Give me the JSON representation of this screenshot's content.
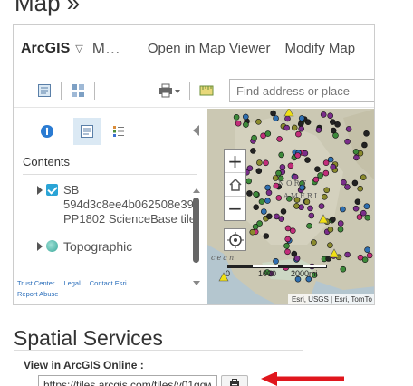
{
  "page": {
    "heading": "Map »"
  },
  "embed": {
    "brand": "ArcGIS",
    "map_title": "M…",
    "links": {
      "open": "Open in Map Viewer",
      "modify": "Modify Map"
    },
    "search": {
      "placeholder": "Find address or place"
    },
    "panel": {
      "contents_label": "Contents",
      "layers": [
        {
          "lines": [
            "SB",
            "594d3c8ee4b062508e39",
            "PP1802 ScienceBase tile"
          ]
        },
        {
          "label": "Topographic"
        }
      ],
      "footer_links": [
        "Trust Center",
        "Legal",
        "Contact Esri",
        "Report Abuse"
      ]
    },
    "map": {
      "labels": [
        "NORT",
        "AMERI",
        "cean"
      ],
      "scale": {
        "left": "0",
        "mid": "1000",
        "right": "2000mi"
      },
      "attribution": "Esri, USGS | Esri, TomTo"
    }
  },
  "services": {
    "heading": "Spatial Services",
    "view_label": "View in ArcGIS Online :",
    "url_value": "https://tiles.arcgis.com/tiles/v01gqw"
  },
  "colors": {
    "accent": "#2aa4d6",
    "annotation": "#e0161d"
  }
}
